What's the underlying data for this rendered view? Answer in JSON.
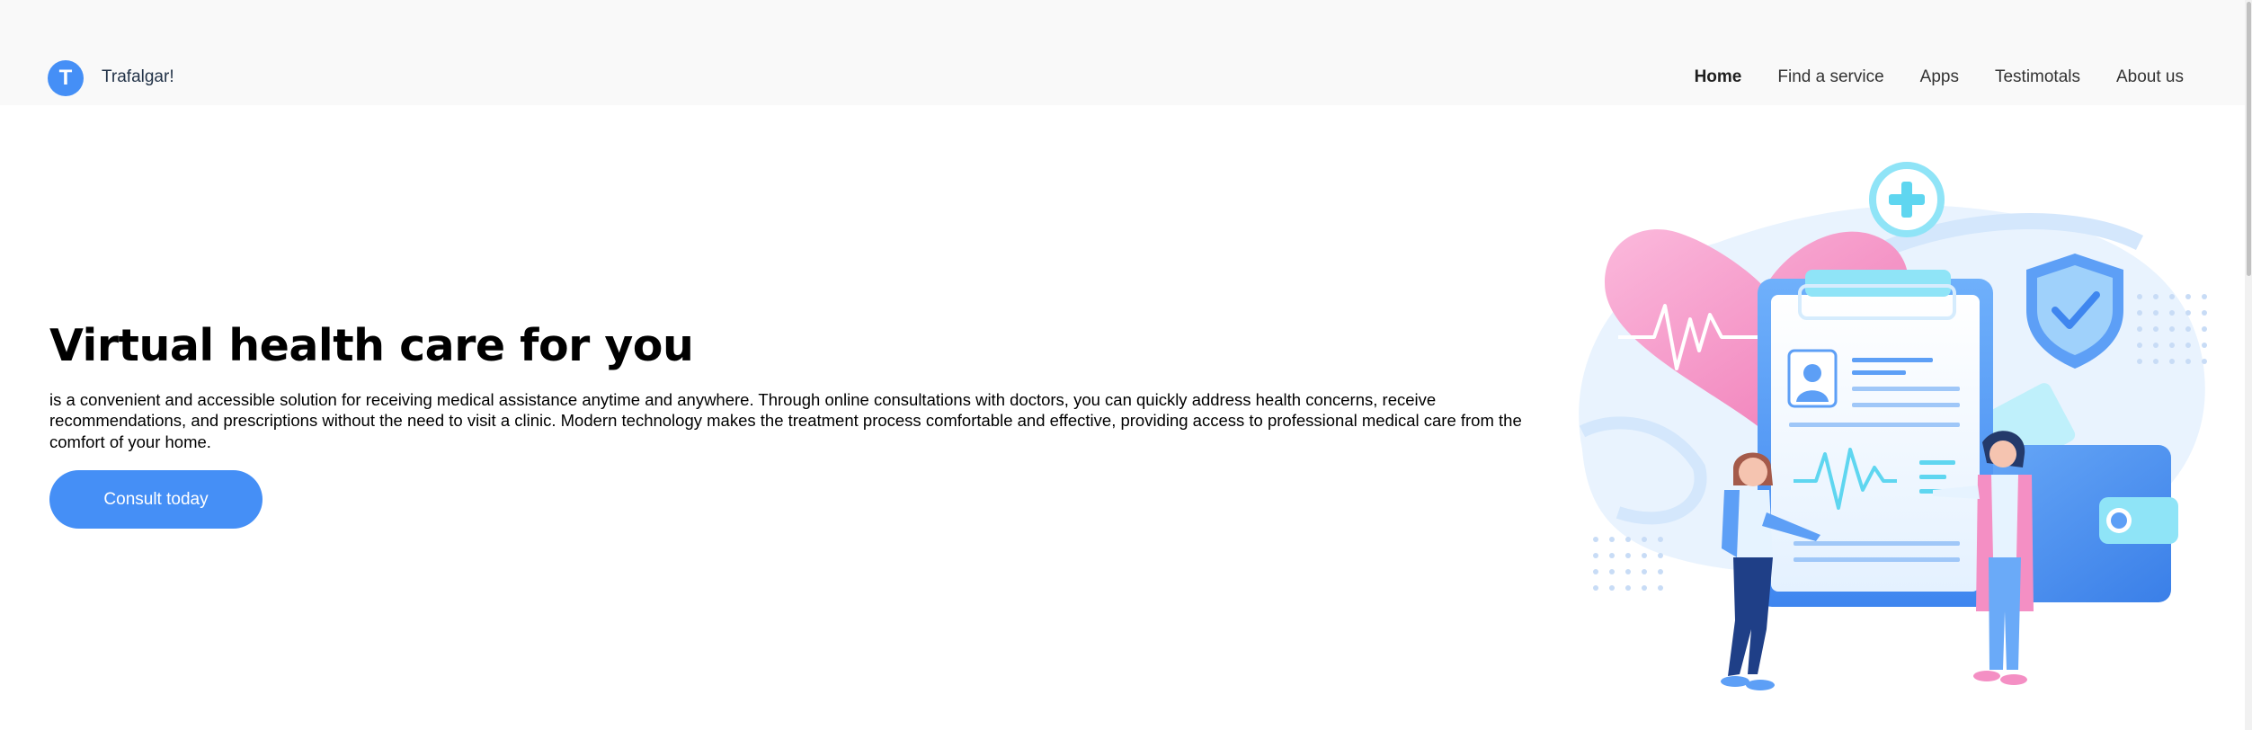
{
  "header": {
    "logo_letter": "T",
    "brand": "Trafalgar!",
    "nav": [
      {
        "label": "Home",
        "active": true
      },
      {
        "label": "Find a service",
        "active": false
      },
      {
        "label": "Apps",
        "active": false
      },
      {
        "label": "Testimotals",
        "active": false
      },
      {
        "label": "About us",
        "active": false
      }
    ]
  },
  "hero": {
    "title": "Virtual health care for you",
    "description": "is a convenient and accessible solution for receiving medical assistance anytime and anywhere. Through online consultations with doctors, you can quickly address health concerns, receive recommendations, and prescriptions without the need to visit a clinic. Modern technology makes the treatment process comfortable and effective, providing access to professional medical care from the comfort of your home.",
    "cta_label": "Consult today"
  },
  "colors": {
    "accent": "#458ff6",
    "header_bg": "#f9f9f9",
    "pink": "#f48fc4",
    "cyan": "#5fd6f0"
  },
  "icons": [
    "heart-icon",
    "plus-icon",
    "shield-check-icon",
    "profile-icon",
    "pulse-icon",
    "wallet-icon"
  ]
}
